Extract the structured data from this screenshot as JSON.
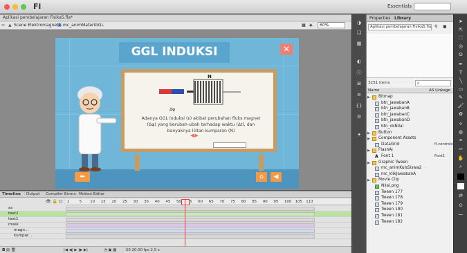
{
  "window": {
    "app_name": "Fl",
    "workspace": "Essentials",
    "search_placeholder": ""
  },
  "doc_tab": "Aplikasi pembelajaran Fisika5.fla*",
  "edit_bar": {
    "scene": "Scene Elektromagnetik",
    "symbol": "mc_animMateriGGL",
    "zoom": "60%"
  },
  "stage": {
    "title": "GGL INDUKSI",
    "close_glyph": "✕",
    "magnet_pole": "N",
    "dphi_label": "Δφ",
    "body_line1": "Adanya GGL Induksi (ε) akibat perubahan fluks magnet",
    "body_line2": "(Δφ) yang berubah-ubah terhadap waktu (Δt), dan",
    "body_line3": "banyaknya lilitan kumparan (N)",
    "nav_arrows": "◀▶",
    "prev_glyph": "⬅",
    "home_glyph": "⌂",
    "sound_glyph": "◀"
  },
  "timeline": {
    "tabs": [
      "Timeline",
      "Output",
      "Compiler Errors",
      "Motion Editor"
    ],
    "ruler": [
      "1",
      "5",
      "10",
      "15",
      "20",
      "25",
      "30",
      "35",
      "40",
      "45",
      "50",
      "55",
      "60",
      "65",
      "70",
      "75",
      "80",
      "85",
      "90",
      "95",
      "100",
      "105",
      "110"
    ],
    "layers": [
      {
        "name": "as",
        "frames_fraction": 0.9
      },
      {
        "name": "text2",
        "frames_fraction": 0.9
      },
      {
        "name": "text1",
        "frames_fraction": 0.9
      },
      {
        "name": "mask",
        "frames_fraction": 0.9
      },
      {
        "name": "magn...",
        "frames_fraction": 0.9
      },
      {
        "name": "kumpar...",
        "frames_fraction": 0.9
      }
    ],
    "current_frame": "50",
    "footer": "50  20.00 fps  2.5 s"
  },
  "library": {
    "tabs": [
      "Properties",
      "Library"
    ],
    "document": "Aplikasi pembelajaran Fisika5.fla",
    "item_count": "3251 items",
    "col_name": "Name",
    "col_linkage": "AS Linkage",
    "items": [
      {
        "name": "Bitmap",
        "type": "folder",
        "link": ""
      },
      {
        "name": "btn_jawabanA",
        "type": "symbol",
        "link": ""
      },
      {
        "name": "btn_jawabanB",
        "type": "symbol",
        "link": ""
      },
      {
        "name": "btn_jawabanC",
        "type": "symbol",
        "link": ""
      },
      {
        "name": "btn_jawabanD",
        "type": "symbol",
        "link": ""
      },
      {
        "name": "btn_okNilai",
        "type": "symbol",
        "link": ""
      },
      {
        "name": "Button",
        "type": "folder",
        "link": ""
      },
      {
        "name": "Component Assets",
        "type": "folder",
        "link": ""
      },
      {
        "name": "DataGrid",
        "type": "symbol",
        "link": "fl.controls.Da"
      },
      {
        "name": "FlashAi",
        "type": "folder",
        "link": ""
      },
      {
        "name": "Font 1",
        "type": "font",
        "link": "Font1"
      },
      {
        "name": "Graphic Tween",
        "type": "folder",
        "link": ""
      },
      {
        "name": "mc_animKuisSiswa2",
        "type": "symbol",
        "link": ""
      },
      {
        "name": "mc_klikJawabanA",
        "type": "symbol",
        "link": ""
      },
      {
        "name": "Movie Clip",
        "type": "folder",
        "link": ""
      },
      {
        "name": "Nilai.png",
        "type": "bitmap",
        "link": ""
      },
      {
        "name": "Tween 177",
        "type": "symbol",
        "link": ""
      },
      {
        "name": "Tween 178",
        "type": "symbol",
        "link": ""
      },
      {
        "name": "Tween 179",
        "type": "symbol",
        "link": ""
      },
      {
        "name": "Tween 180",
        "type": "symbol",
        "link": ""
      },
      {
        "name": "Tween 181",
        "type": "symbol",
        "link": ""
      },
      {
        "name": "Tween 182",
        "type": "symbol",
        "link": ""
      }
    ]
  },
  "colors": {
    "stage_bg": "#6fb6d9",
    "board_frame": "#c79c63",
    "accent_orange": "#f29a48",
    "close_red": "#f07f72",
    "playhead": "#e23b3b"
  }
}
